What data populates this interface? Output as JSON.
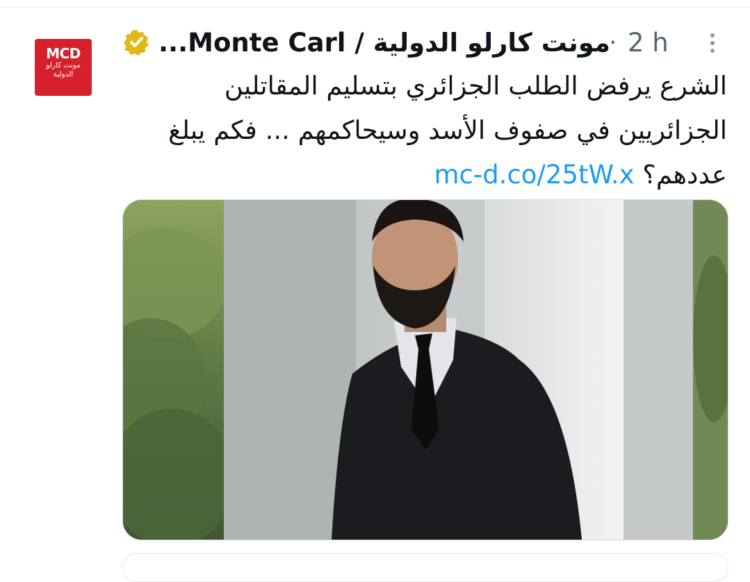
{
  "tweet": {
    "avatar": {
      "logo_text": "MCD",
      "logo_sub_line1": "مونت كارلو",
      "logo_sub_line2": "الدولية"
    },
    "display_name": "مونت كارلو الدولية / Monte Carl...",
    "separator": "·",
    "timestamp": "2 h",
    "text_body": "الشرع يرفض الطلب الجزائري بتسليم المقاتلين الجزائريين في صفوف الأسد وسيحاكمهم ... فكم يبلغ عددهم؟",
    "link": "mc-d.co/25tW.x",
    "icons": {
      "verified": "verified-badge-icon",
      "more": "more-options-icon"
    },
    "colors": {
      "link": "#1d9bf0",
      "verified_badge": "#e2b719",
      "logo_background": "#d6202b"
    }
  }
}
